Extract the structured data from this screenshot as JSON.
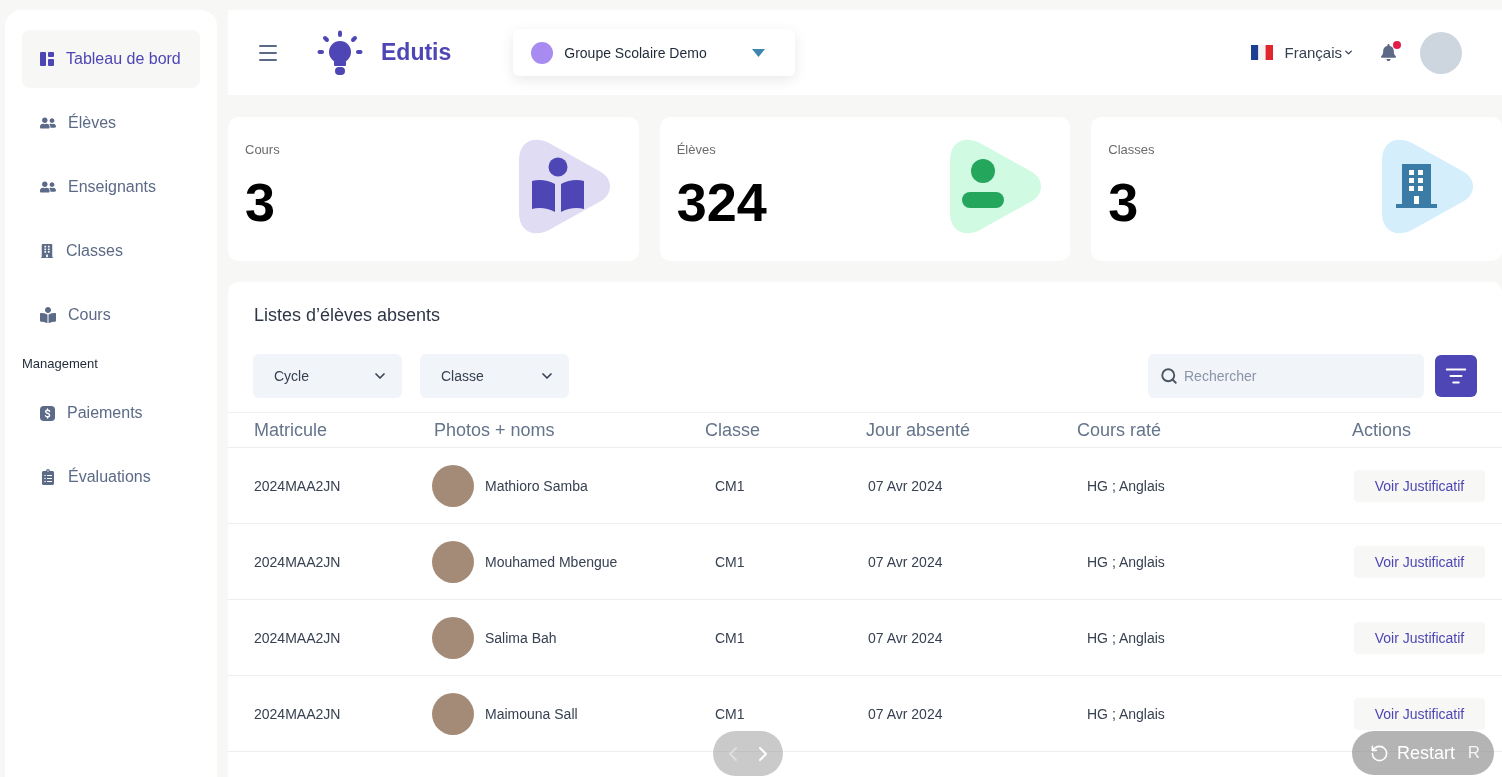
{
  "sidebar": {
    "sections": [
      {
        "items": [
          {
            "label": "Tableau de bord",
            "selected": true
          },
          {
            "label": "Élèves",
            "selected": false
          },
          {
            "label": "Enseignants",
            "selected": false
          },
          {
            "label": "Classes",
            "selected": false
          },
          {
            "label": "Cours",
            "selected": false
          }
        ]
      },
      {
        "title": "Management",
        "items": [
          {
            "label": "Paiements",
            "selected": false
          },
          {
            "label": "Évaluations",
            "selected": false
          }
        ]
      }
    ]
  },
  "topbar": {
    "brand": "Edutis",
    "school_selector": {
      "value": "Groupe Scolaire Demo"
    },
    "language": {
      "label": "Français"
    },
    "notifications": {
      "unread": true
    }
  },
  "stats": [
    {
      "kind": "courses",
      "label": "Cours",
      "value": "3"
    },
    {
      "kind": "students",
      "label": "Élèves",
      "value": "324"
    },
    {
      "kind": "classes",
      "label": "Classes",
      "value": "3"
    }
  ],
  "absences": {
    "title": "Listes d’élèves absents",
    "filters": [
      {
        "label": "Cycle"
      },
      {
        "label": "Classe"
      }
    ],
    "search": {
      "placeholder": "Rechercher"
    },
    "table": {
      "columns": [
        "Matricule",
        "Photos + noms",
        "Classe",
        "Jour absenté",
        "Cours raté",
        "Actions"
      ],
      "rows": [
        {
          "matricule": "2024MAA2JN",
          "name": "Mathioro Samba",
          "class": "CM1",
          "date": "07 Avr 2024",
          "courses": "HG ; Anglais",
          "action": "Voir Justificatif"
        },
        {
          "matricule": "2024MAA2JN",
          "name": "Mouhamed Mbengue",
          "class": "CM1",
          "date": "07 Avr 2024",
          "courses": "HG ; Anglais",
          "action": "Voir Justificatif"
        },
        {
          "matricule": "2024MAA2JN",
          "name": "Salima Bah",
          "class": "CM1",
          "date": "07 Avr 2024",
          "courses": "HG ; Anglais",
          "action": "Voir Justificatif"
        },
        {
          "matricule": "2024MAA2JN",
          "name": "Maimouna Sall",
          "class": "CM1",
          "date": "07 Avr 2024",
          "courses": "HG ; Anglais",
          "action": "Voir Justificatif"
        }
      ]
    }
  },
  "player_controls": {
    "previous": {
      "disabled": true
    },
    "next": {
      "disabled": false
    },
    "restart": {
      "label": "Restart",
      "shortcut": "R"
    }
  }
}
